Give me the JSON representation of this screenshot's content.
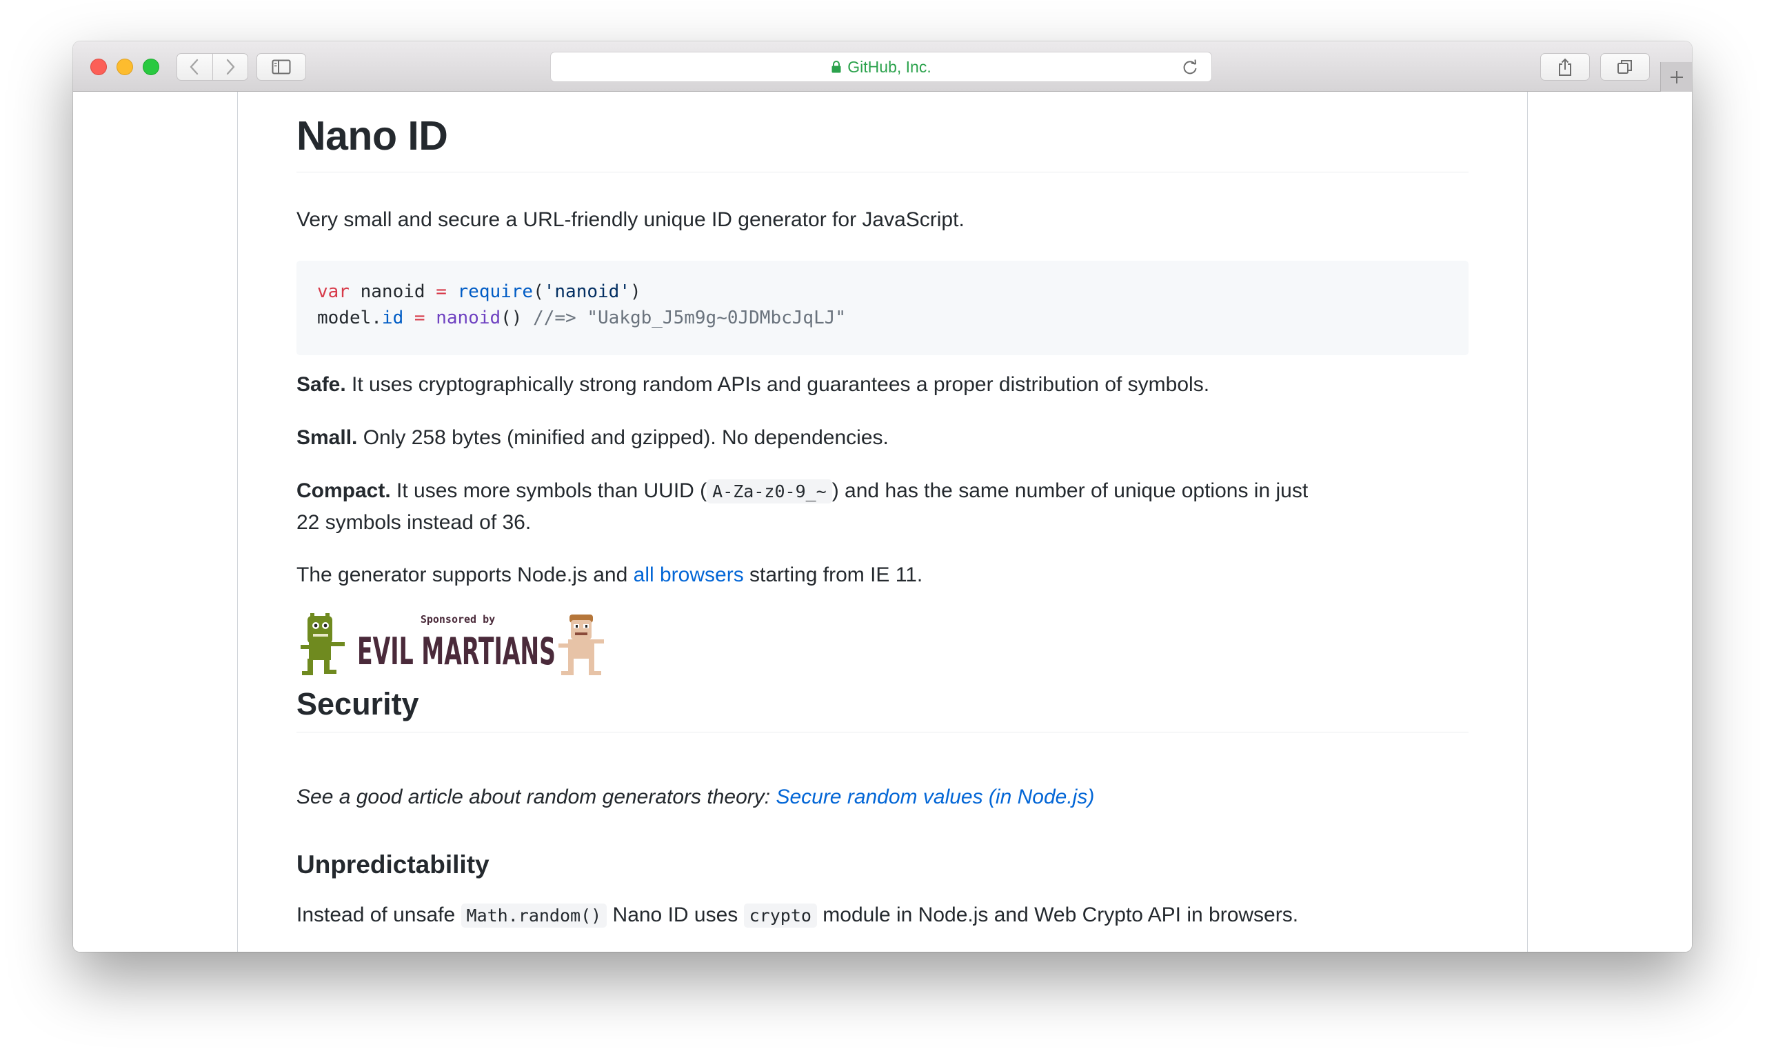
{
  "browser": {
    "url_text": "GitHub, Inc.",
    "icons": [
      "back-icon",
      "forward-icon",
      "sidebar-icon",
      "lock-icon",
      "reload-icon",
      "share-icon",
      "tabs-icon",
      "plus-icon"
    ]
  },
  "readme": {
    "title": "Nano ID",
    "intro": "Very small and secure a URL-friendly unique ID generator for JavaScript.",
    "code": {
      "line1": {
        "kw": "var",
        "name": " nanoid ",
        "eq": "=",
        "sp": " ",
        "fn": "require",
        "open": "(",
        "str": "'nanoid'",
        "close": ")"
      },
      "line2": {
        "obj": "model.",
        "prop": "id",
        "sp1": " ",
        "eq": "=",
        "sp2": " ",
        "fn": "nanoid",
        "paren": "()",
        "comment": " //=> \"Uakgb_J5m9g~0JDMbcJqLJ\""
      }
    },
    "safe": {
      "label": "Safe.",
      "text": " It uses cryptographically strong random APIs and guarantees a proper distribution of symbols."
    },
    "small": {
      "label": "Small.",
      "text": " Only 258 bytes (minified and gzipped). No dependencies."
    },
    "compact": {
      "label": "Compact.",
      "text_before": " It uses more symbols than UUID (",
      "code": "A-Za-z0-9_~",
      "text_after": ") and has the same number of unique options in just 22 symbols instead of 36."
    },
    "browsers": {
      "before": "The generator supports Node.js and ",
      "link": "all browsers",
      "after": " starting from IE 11."
    },
    "sponsor": {
      "top": "Sponsored by",
      "name": "EVIL MARTIANS"
    },
    "security_heading": "Security",
    "article_note": {
      "text": "See a good article about random generators theory: ",
      "link": "Secure random values (in Node.js)"
    },
    "unpredictability_heading": "Unpredictability",
    "unsafe": {
      "t1": "Instead of unsafe ",
      "c1": "Math.random()",
      "t2": " Nano ID uses ",
      "c2": "crypto",
      "t3": " module in Node.js and Web Crypto API in browsers."
    }
  }
}
